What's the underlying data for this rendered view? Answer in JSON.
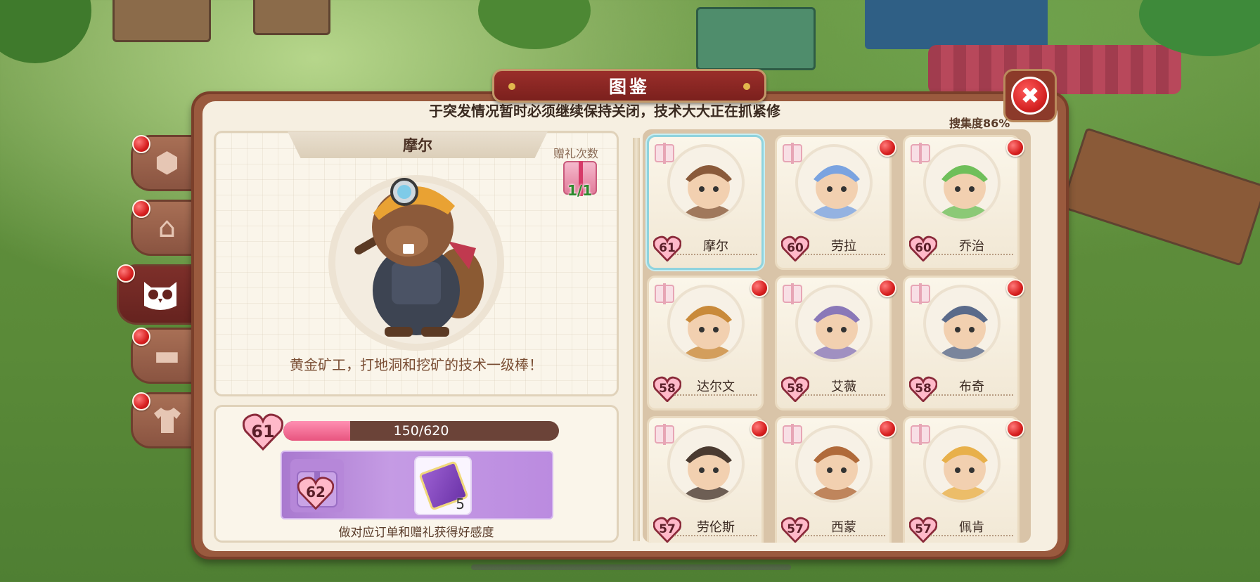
{
  "title": "图鉴",
  "marquee": "于突发情况暂时必须继续保持关闭，技术大大正在抓紧修",
  "marquee_visible_prefix": "",
  "collection_label": "搜集度86%",
  "side_tabs": [
    {
      "icon": "box-icon",
      "glyph": "⬡",
      "active": false,
      "has_badge": true
    },
    {
      "icon": "house-icon",
      "glyph": "⌂",
      "active": false,
      "has_badge": true
    },
    {
      "icon": "owl-icon",
      "glyph": "🦉",
      "active": true,
      "has_badge": true
    },
    {
      "icon": "sofa-icon",
      "glyph": "▭",
      "active": false,
      "has_badge": true
    },
    {
      "icon": "shirt-icon",
      "glyph": "👕",
      "active": false,
      "has_badge": true
    }
  ],
  "profile": {
    "name": "摩尔",
    "gift_label": "赠礼次数",
    "gift_count": "1/1",
    "description": "黄金矿工，打地洞和挖矿的技术一级棒！"
  },
  "affinity": {
    "level": "61",
    "progress_text": "150/620",
    "progress_fraction": 0.2419,
    "next_level": "62",
    "reward_qty": "5",
    "hint": "做对应订单和赠礼获得好感度"
  },
  "characters": [
    {
      "name": "摩尔",
      "level": "61",
      "selected": true,
      "badge": false
    },
    {
      "name": "劳拉",
      "level": "60",
      "selected": false,
      "badge": true
    },
    {
      "name": "乔治",
      "level": "60",
      "selected": false,
      "badge": true
    },
    {
      "name": "达尔文",
      "level": "58",
      "selected": false,
      "badge": true
    },
    {
      "name": "艾薇",
      "level": "58",
      "selected": false,
      "badge": true
    },
    {
      "name": "布奇",
      "level": "58",
      "selected": false,
      "badge": true
    },
    {
      "name": "劳伦斯",
      "level": "57",
      "selected": false,
      "badge": true
    },
    {
      "name": "西蒙",
      "level": "57",
      "selected": false,
      "badge": true
    },
    {
      "name": "佩肯",
      "level": "57",
      "selected": false,
      "badge": true
    }
  ],
  "colors": {
    "accent_red": "#d42222",
    "affinity_pink": "#e8557f",
    "reward_purple": "#a979cf",
    "selected_border": "#8fd3de"
  }
}
